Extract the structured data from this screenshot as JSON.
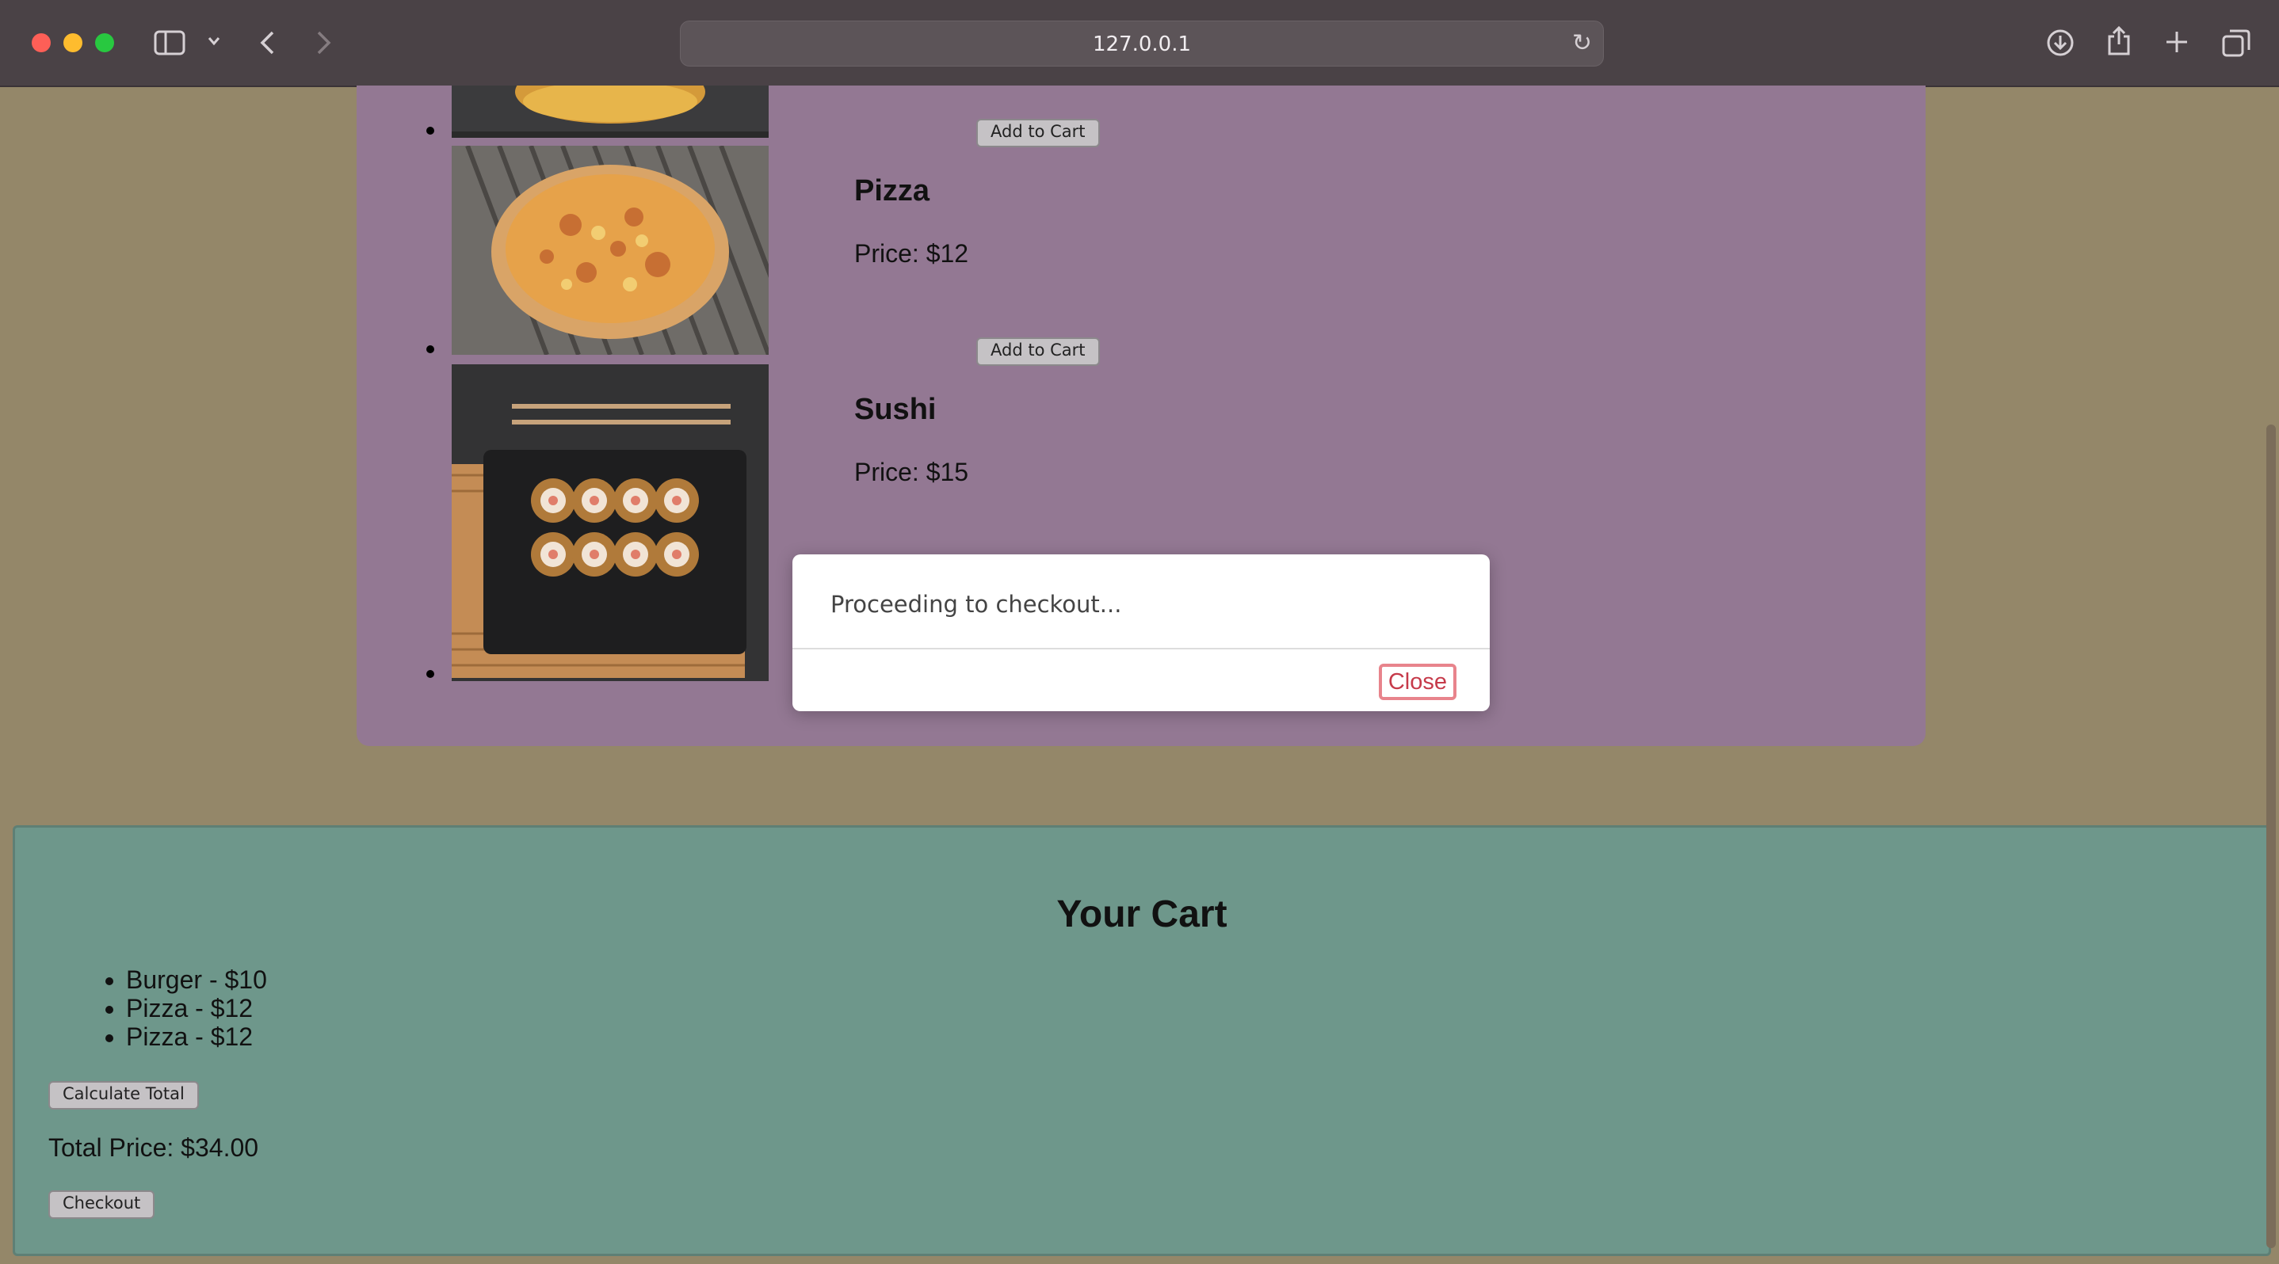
{
  "browser": {
    "url": "127.0.0.1"
  },
  "menu": {
    "add_to_cart_label": "Add to Cart",
    "items": [
      {
        "name": "Pizza",
        "price": "Price: $12",
        "image": "pizza-photo"
      },
      {
        "name": "Sushi",
        "price": "Price: $15",
        "image": "sushi-photo"
      }
    ]
  },
  "cart": {
    "title": "Your Cart",
    "items": [
      "Burger - $10",
      "Pizza - $12",
      "Pizza - $12"
    ],
    "calculate_label": "Calculate Total",
    "total": "Total Price: $34.00",
    "checkout_label": "Checkout"
  },
  "modal": {
    "message": "Proceeding to checkout...",
    "close_label": "Close"
  },
  "colors": {
    "menu_bg": "#937893",
    "cart_bg": "#6e978b",
    "page_bg": "#948769",
    "close_accent": "#c63a4a"
  }
}
